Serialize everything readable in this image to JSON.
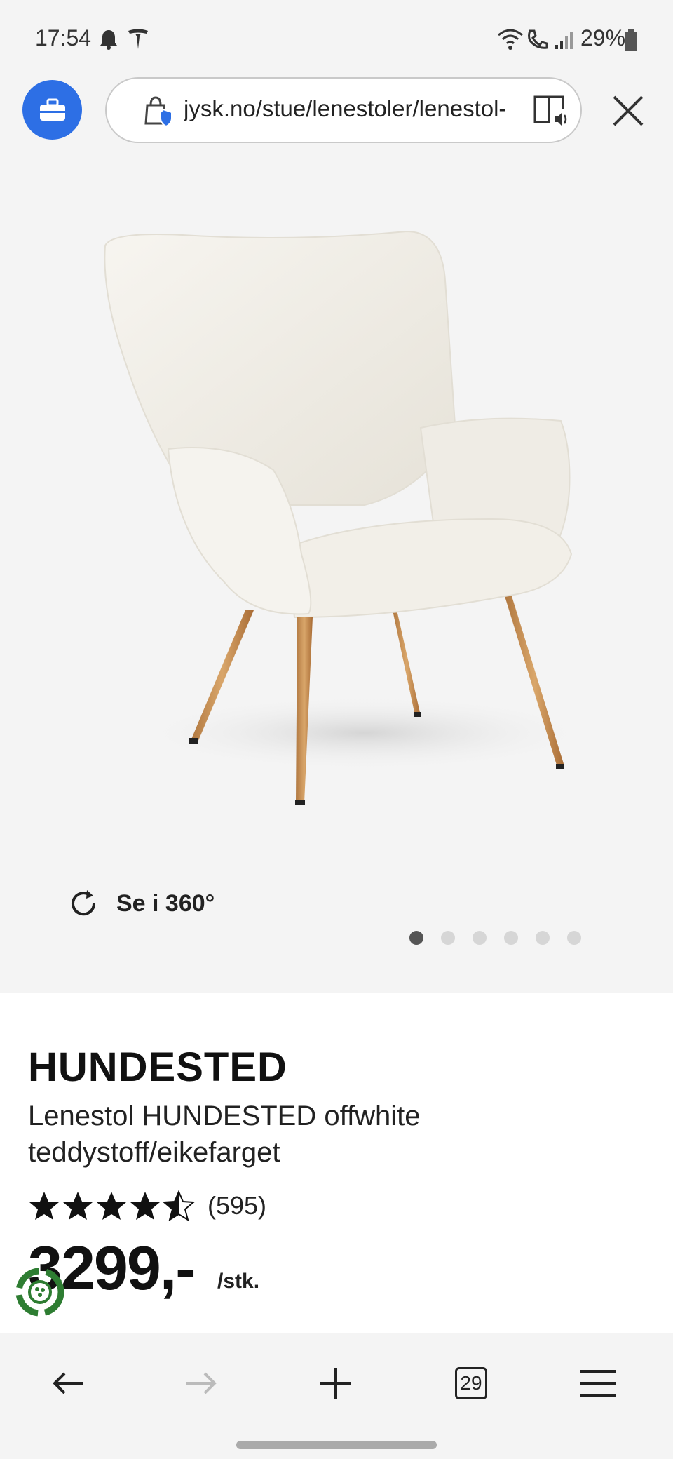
{
  "status_bar": {
    "time": "17:54",
    "battery": "29%",
    "icons": [
      "bell-icon",
      "tesla-icon",
      "wifi-icon",
      "call-icon",
      "signal-icon",
      "battery-icon"
    ]
  },
  "browser": {
    "url": "jysk.no/stue/lenestoler/lenestol-",
    "accent": "#2d6fe5"
  },
  "gallery": {
    "view360_label": "Se i 360°",
    "image_count": 6,
    "active_index": 0
  },
  "product": {
    "brand": "HUNDESTED",
    "description": "Lenestol HUNDESTED offwhite teddystoff/eikefarget",
    "rating_count": "(595)",
    "rating_stars": 4.5,
    "price": "3299,-",
    "unit": "/stk."
  },
  "bottom_nav": {
    "tabs_count": "29",
    "items": [
      "back-icon",
      "forward-icon",
      "new-tab-icon",
      "tabs-icon",
      "menu-icon"
    ]
  }
}
